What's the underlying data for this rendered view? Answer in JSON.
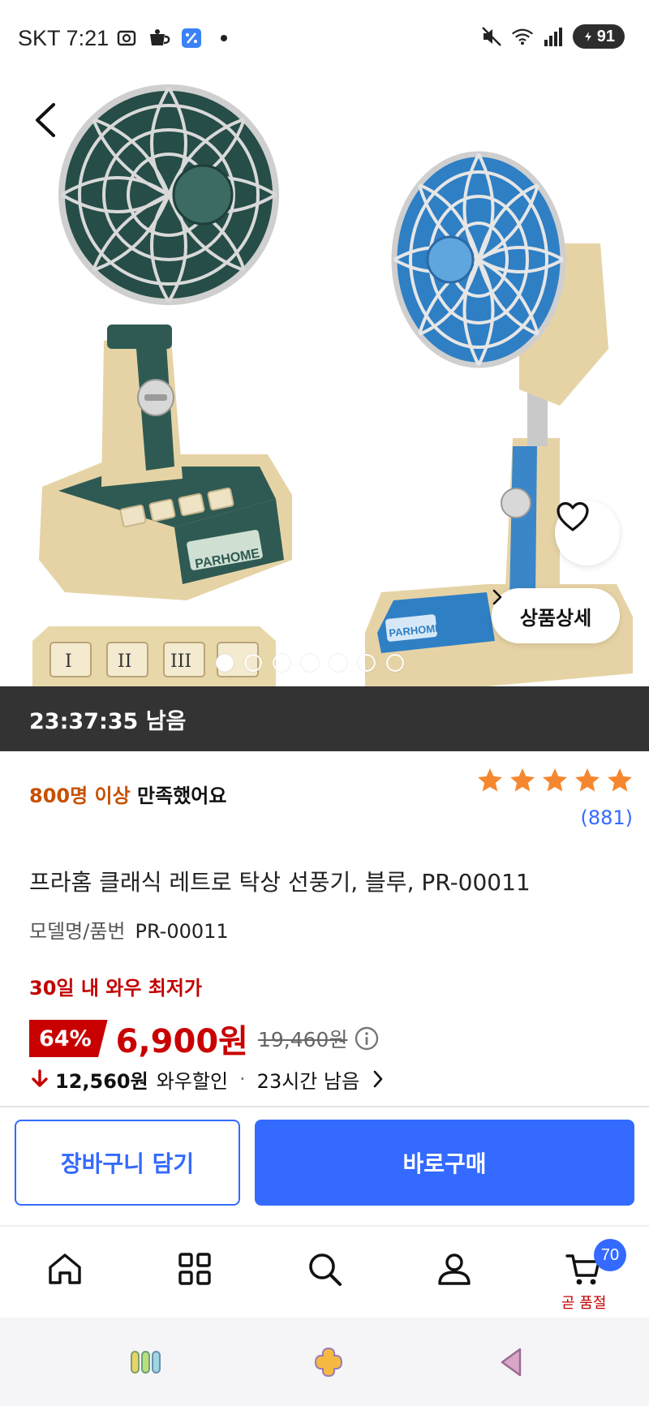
{
  "status_bar": {
    "carrier": "SKT",
    "time": "7:21",
    "battery": "91"
  },
  "hero": {
    "detail_label": "상품상세",
    "slide_count": 7,
    "active_slide": 1,
    "brand_label": "PARHOME"
  },
  "countdown": {
    "text": "23:37:35 남음"
  },
  "rating": {
    "satisfied_highlight": "800명 이상",
    "satisfied_rest": " 만족했어요",
    "stars": 5,
    "review_count": "(881)"
  },
  "product": {
    "title": "프라홈 클래식 레트로 탁상 선풍기, 블루, PR-00011",
    "model_label": "모델명/품번",
    "model_value": "PR-00011",
    "lowest_label": "30일 내 와우 최저가",
    "discount": "64%",
    "price": "6,900원",
    "original_price": "19,460원",
    "wow_amount": "12,560원",
    "wow_label": "와우할인",
    "wow_sep": "·",
    "wow_time": "23시간 남음"
  },
  "actions": {
    "cart_label": "장바구니 담기",
    "buy_label": "바로구매"
  },
  "bottom_nav": {
    "cart_badge": "70",
    "soldout_label": "곧 품절"
  },
  "colors": {
    "accent": "#346aff",
    "price_red": "#c80000",
    "star": "#f5882e",
    "countdown_bg": "#333333"
  }
}
